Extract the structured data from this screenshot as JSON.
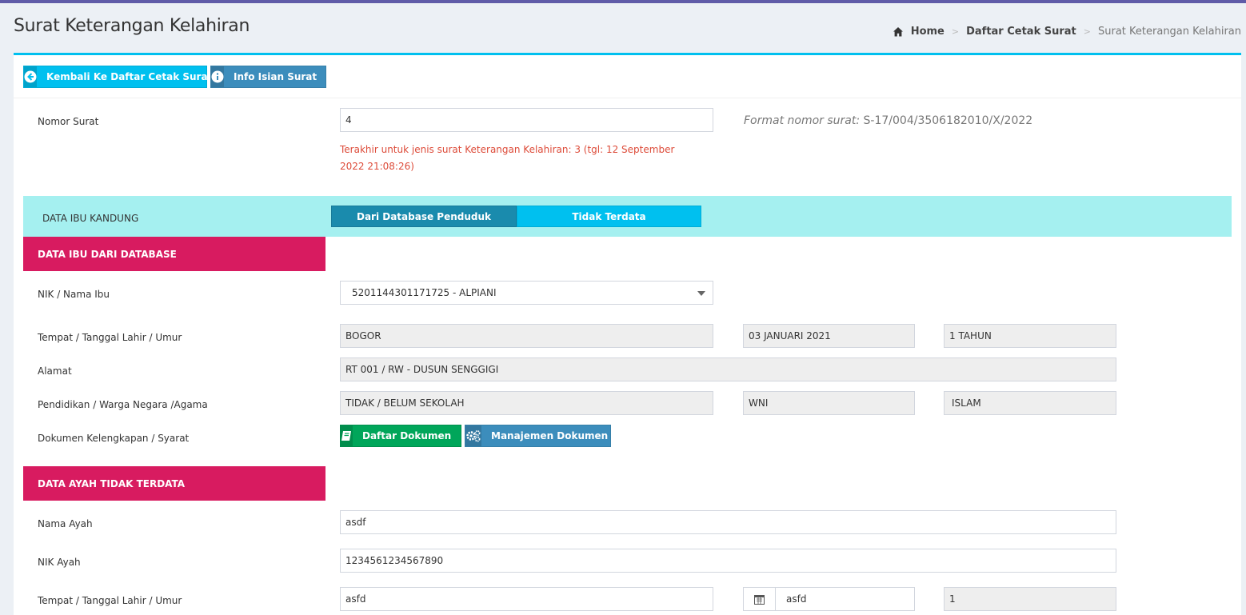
{
  "header": {
    "title": "Surat Keterangan Kelahiran",
    "breadcrumb": [
      "Home",
      "Daftar Cetak Surat",
      "Surat Keterangan Kelahiran"
    ]
  },
  "toolbar": {
    "back_label": "Kembali Ke Daftar Cetak Surat",
    "info_label": "Info Isian Surat"
  },
  "nomor_surat": {
    "label": "Nomor Surat",
    "value": "4",
    "hint": "Terakhir untuk jenis surat Keterangan Kelahiran: 3 (tgl: 12 September 2022 21:08:26)",
    "format_label": "Format nomor surat:",
    "format_value": "S-17/004/3506182010/X/2022"
  },
  "ibu": {
    "band_title": "DATA IBU KANDUNG",
    "tab_database": "Dari Database Penduduk",
    "tab_tidak_terdata": "Tidak Terdata",
    "section_title": "DATA IBU DARI DATABASE",
    "nik_label": "NIK / Nama Ibu",
    "nik_value": "5201144301171725 - ALPIANI",
    "ttl_label": "Tempat / Tanggal Lahir / Umur",
    "tempat": "BOGOR",
    "tanggal": "03 JANUARI 2021",
    "umur": "1 TAHUN",
    "alamat_label": "Alamat",
    "alamat": "RT 001 / RW - DUSUN SENGGIGI",
    "pendidikan_label": "Pendidikan / Warga Negara /Agama",
    "pendidikan": "TIDAK / BELUM SEKOLAH",
    "warga_negara": "WNI",
    "agama": "ISLAM",
    "dokumen_label": "Dokumen Kelengkapan / Syarat",
    "daftar_dokumen": "Daftar Dokumen",
    "manajemen_dokumen": "Manajemen Dokumen"
  },
  "ayah": {
    "section_title": "DATA AYAH TIDAK TERDATA",
    "nama_label": "Nama Ayah",
    "nama_value": "asdf",
    "nik_label": "NIK Ayah",
    "nik_value": "1234561234567890",
    "ttl_label": "Tempat / Tanggal Lahir / Umur",
    "tempat": "asfd",
    "tanggal": "asfd",
    "umur": "1"
  },
  "colors": {
    "accent_top": "#605ca8",
    "box_border": "#00c0ef",
    "band": "#a5f0f0",
    "section": "#d81b60",
    "hint": "#dd4b39"
  }
}
